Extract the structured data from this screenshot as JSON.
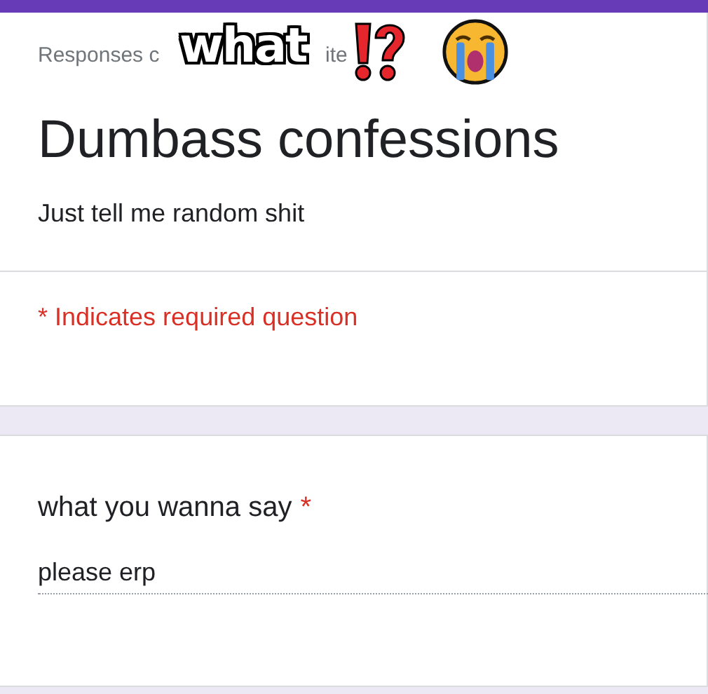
{
  "caption": {
    "text": "what"
  },
  "header": {
    "notice_fragments": [
      "Responses c",
      "ite"
    ],
    "title": "Dumbass confessions",
    "description": "Just tell me random shit",
    "required_note": "* Indicates required question"
  },
  "question": {
    "label": "what you wanna say",
    "required": true,
    "required_marker": "*",
    "value": "please erp"
  }
}
